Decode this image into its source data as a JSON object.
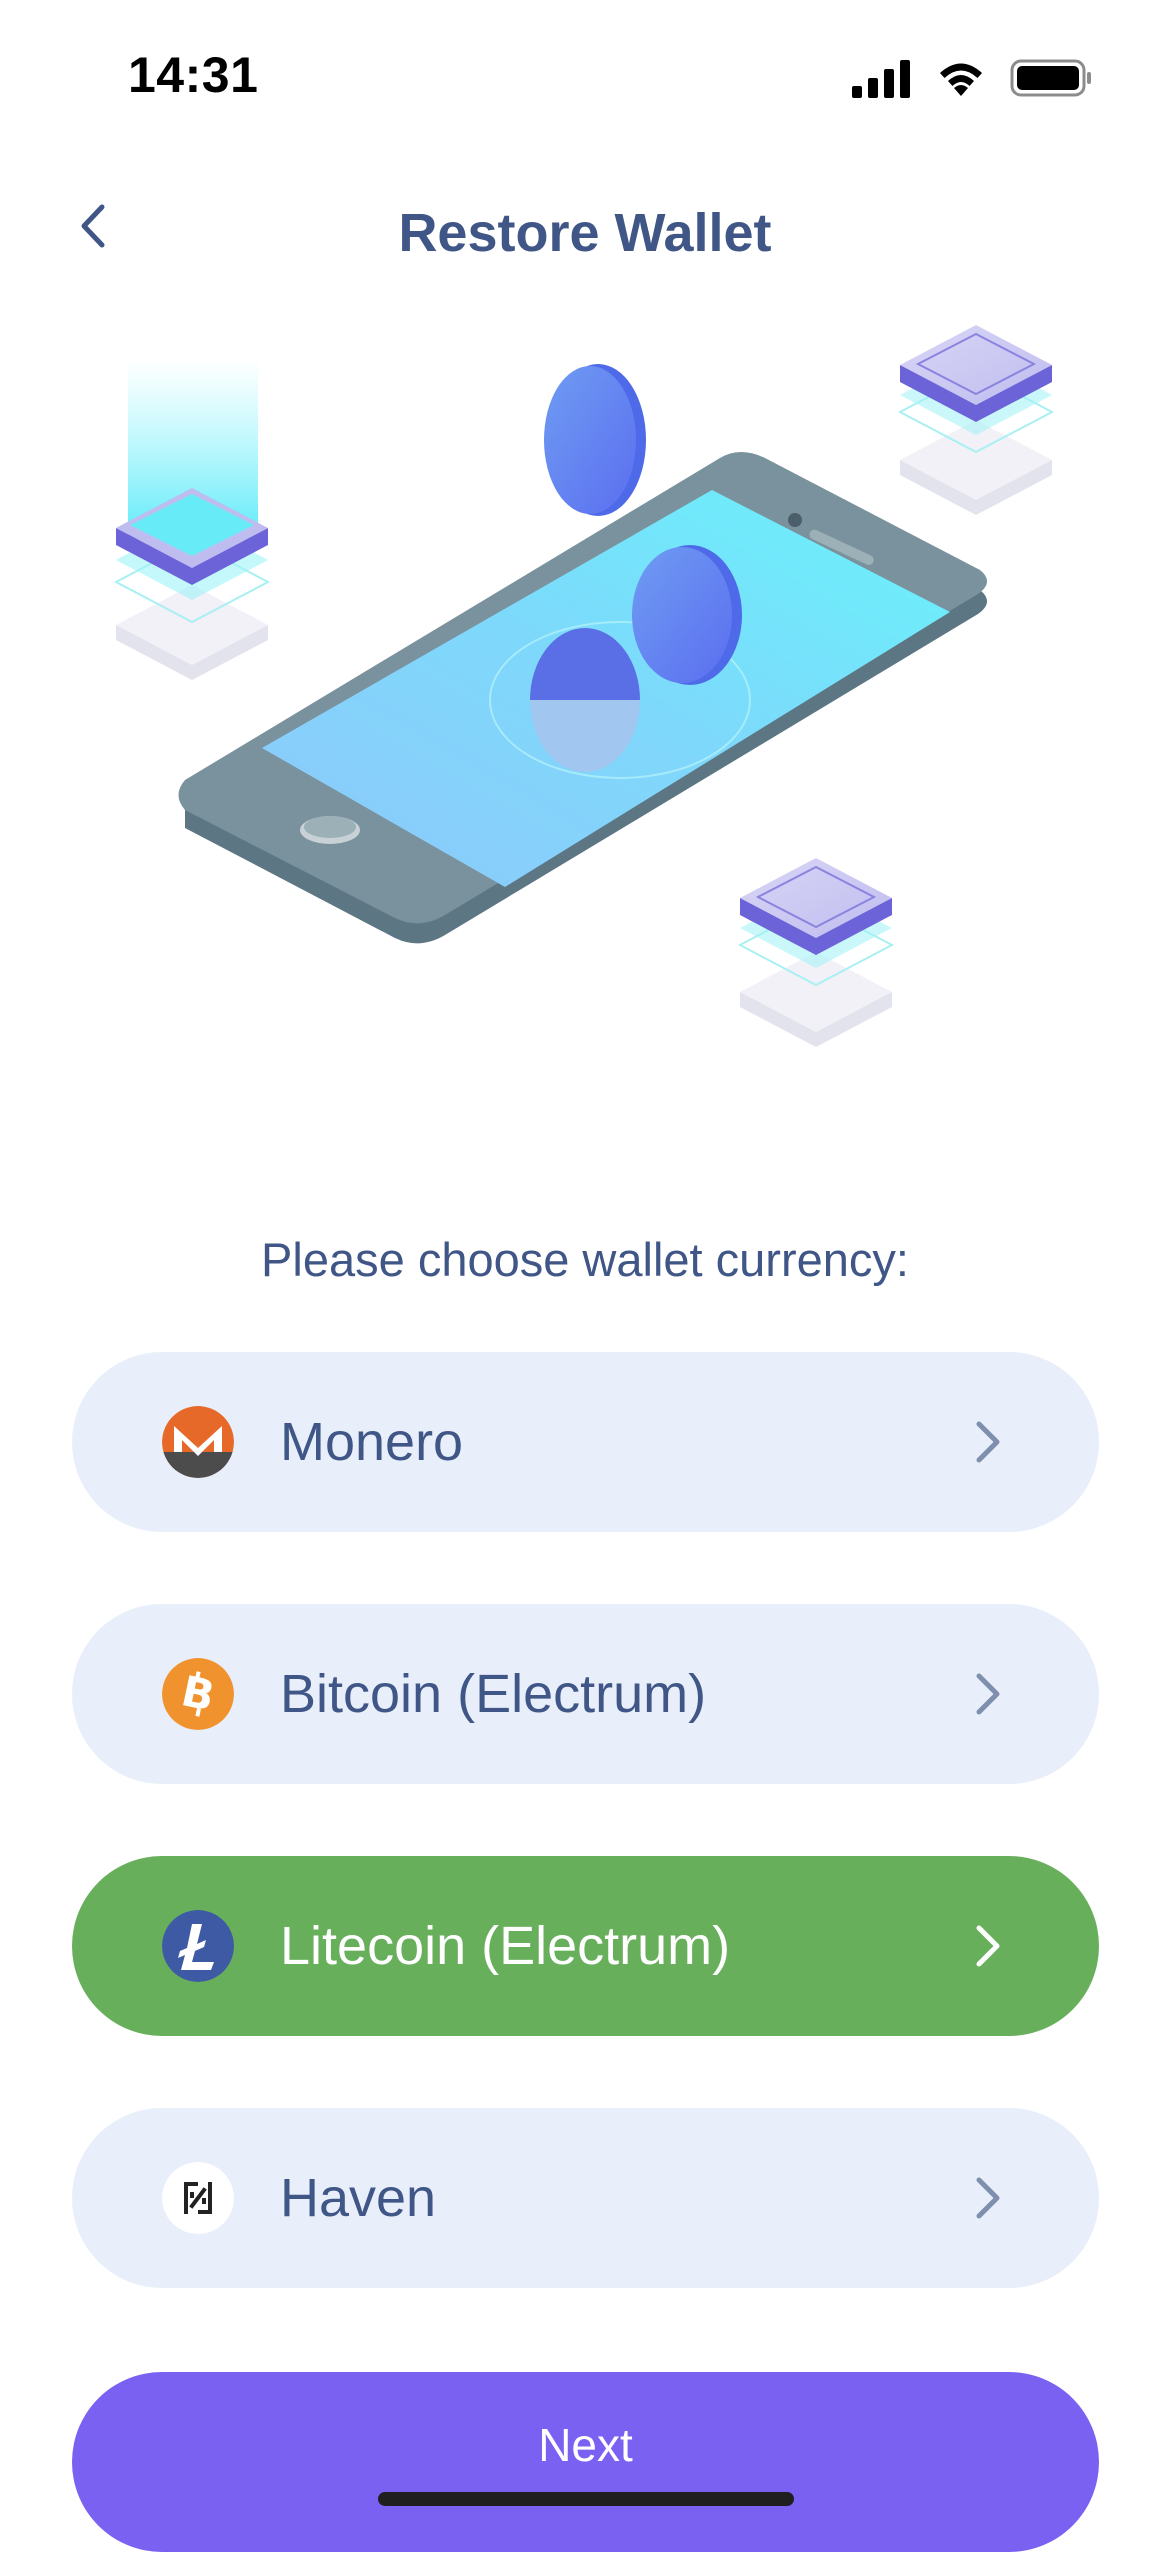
{
  "status_bar": {
    "time": "14:31",
    "icons": [
      "cellular-signal-icon",
      "wifi-icon",
      "battery-icon"
    ]
  },
  "header": {
    "title": "Restore Wallet",
    "back_icon": "chevron-left-icon"
  },
  "prompt": "Please choose wallet currency:",
  "currencies": [
    {
      "label": "Monero",
      "icon": "monero-icon",
      "selected": false
    },
    {
      "label": "Bitcoin (Electrum)",
      "icon": "bitcoin-icon",
      "selected": false
    },
    {
      "label": "Litecoin (Electrum)",
      "icon": "litecoin-icon",
      "selected": true
    },
    {
      "label": "Haven",
      "icon": "haven-icon",
      "selected": false
    }
  ],
  "next_button": {
    "label": "Next"
  },
  "colors": {
    "text_primary": "#3f5686",
    "option_bg": "#e8effa",
    "option_selected_bg": "#68af5c",
    "next_bg": "#7b61f2"
  }
}
